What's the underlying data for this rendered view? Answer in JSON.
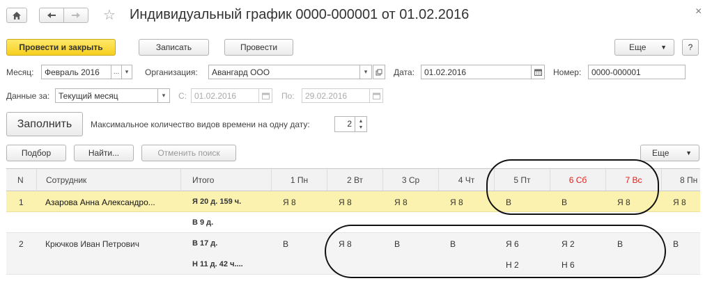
{
  "window": {
    "title": "Индивидуальный график 0000-000001 от 01.02.2016",
    "home_icon": "home-icon",
    "back_icon": "arrow-left-icon",
    "forward_icon": "arrow-right-icon",
    "star": "☆",
    "close": "×"
  },
  "toolbar": {
    "post_close": "Провести и закрыть",
    "save": "Записать",
    "post": "Провести",
    "more": "Еще",
    "help": "?"
  },
  "form": {
    "month_label": "Месяц:",
    "month_value": "Февраль 2016",
    "org_label": "Организация:",
    "org_value": "Авангард ООО",
    "date_label": "Дата:",
    "date_value": "01.02.2016",
    "number_label": "Номер:",
    "number_value": "0000-000001",
    "data_for_label": "Данные за:",
    "data_for_value": "Текущий месяц",
    "from_label": "С:",
    "from_value": "01.02.2016",
    "to_label": "По:",
    "to_value": "29.02.2016",
    "fill_button": "Заполнить",
    "max_types_label": "Максимальное количество видов времени на одну дату:",
    "max_types_value": "2"
  },
  "table_toolbar": {
    "select": "Подбор",
    "find": "Найти...",
    "cancel_search": "Отменить поиск",
    "more": "Еще"
  },
  "table": {
    "headers": {
      "n": "N",
      "employee": "Сотрудник",
      "total": "Итого",
      "days": [
        "1 Пн",
        "2 Вт",
        "3 Ср",
        "4 Чт",
        "5 Пт",
        "6 Сб",
        "7 Вс",
        "8 Пн"
      ]
    },
    "rows": [
      {
        "n": "1",
        "employee": "Азарова Анна Александро...",
        "total_1": "Я 20 д. 159 ч.",
        "total_2": "В 9 д.",
        "days_1": [
          "Я 8",
          "Я 8",
          "Я 8",
          "Я 8",
          "В",
          "В",
          "Я 8",
          "Я 8"
        ],
        "days_2": [
          "",
          "",
          "",
          "",
          "",
          "",
          "",
          ""
        ]
      },
      {
        "n": "2",
        "employee": "Крючков Иван Петрович",
        "total_1": "В 17 д.",
        "total_2": "Н 11 д. 42 ч....",
        "days_1": [
          "В",
          "Я 8",
          "В",
          "В",
          "Я 6",
          "Я 2",
          "В",
          "В"
        ],
        "days_2": [
          "",
          "",
          "",
          "",
          "Н 2",
          "Н 6",
          "",
          ""
        ]
      }
    ]
  },
  "colors": {
    "selected_row": "#fbf2b0",
    "primary_button": "#f6cf1e",
    "weekend": "#e0201c"
  }
}
